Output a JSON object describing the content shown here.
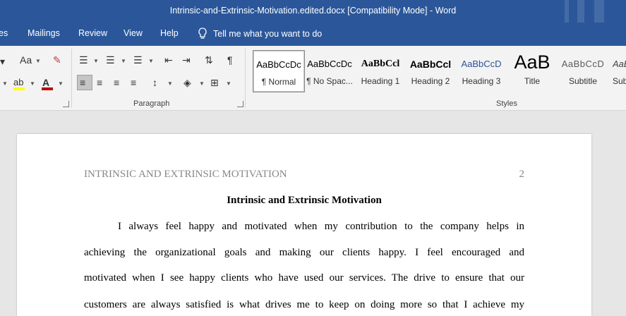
{
  "window": {
    "title": "Intrinsic-and-Extrinsic-Motivation.edited.docx [Compatibility Mode]  -  Word"
  },
  "tabs": [
    "es",
    "Mailings",
    "Review",
    "View",
    "Help"
  ],
  "tell_me": "Tell me what you want to do",
  "ribbon": {
    "font_size_dropdown": "Aa",
    "groups": {
      "paragraph": "Paragraph",
      "styles": "Styles"
    },
    "styles": [
      {
        "sample": "AaBbCcDc",
        "name": "¶ Normal"
      },
      {
        "sample": "AaBbCcDc",
        "name": "¶ No Spac..."
      },
      {
        "sample": "AaBbCcl",
        "name": "Heading 1"
      },
      {
        "sample": "AaBbCcl",
        "name": "Heading 2"
      },
      {
        "sample": "AaBbCcD",
        "name": "Heading 3"
      },
      {
        "sample": "AaB",
        "name": "Title"
      },
      {
        "sample": "AaBbCcD",
        "name": "Subtitle"
      },
      {
        "sample": "AaBbCcD",
        "name": "Sub"
      }
    ]
  },
  "document": {
    "header_left": "INTRINSIC AND EXTRINSIC MOTIVATION",
    "page_number": "2",
    "title": "Intrinsic and Extrinsic Motivation",
    "lines": [
      "I always feel happy and motivated when my contribution to the company helps in",
      "achieving the organizational goals and making our clients happy. I feel encouraged and",
      "motivated when I see happy clients who have used our services. The drive to ensure that our",
      "customers are always satisfied is what drives me to keep on doing more so that I achieve my"
    ]
  },
  "colors": {
    "titlebar": "#2b579a",
    "ribbon": "#f3f3f3",
    "canvas": "#e6e6e6",
    "font_color_red": "#c00000",
    "highlight_yellow": "#ffff00"
  }
}
